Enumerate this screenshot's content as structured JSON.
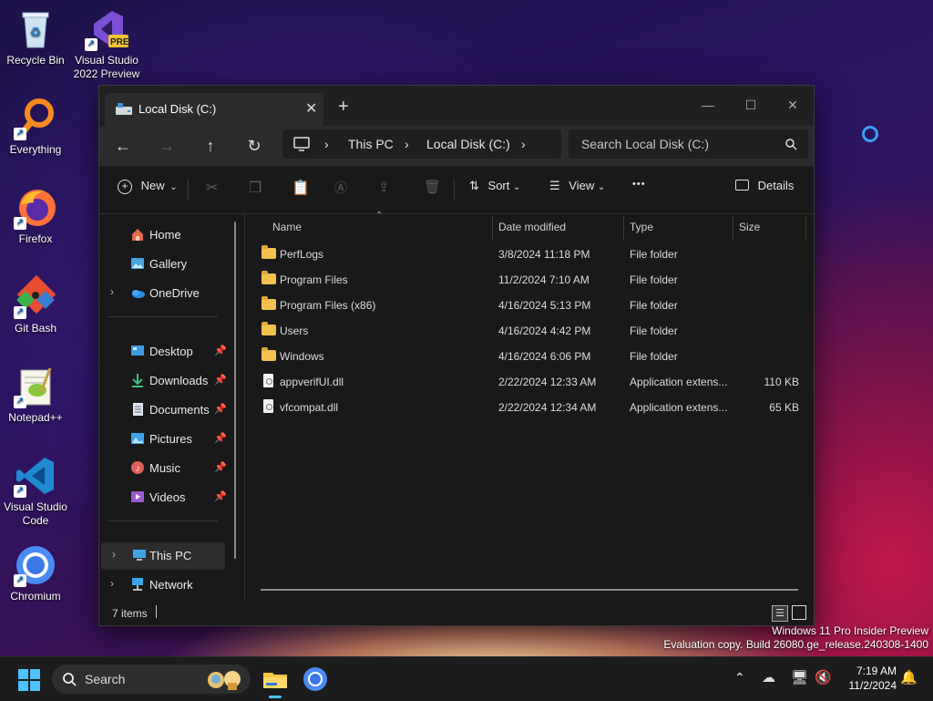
{
  "desktop": {
    "icons": [
      {
        "label": "Recycle Bin",
        "icon": "recycle-bin-icon"
      },
      {
        "label": "Visual Studio 2022 Preview",
        "icon": "visual-studio-preview-icon",
        "badge": "PRE"
      },
      {
        "label": "Everything",
        "icon": "everything-search-icon"
      },
      {
        "label": "Firefox",
        "icon": "firefox-icon"
      },
      {
        "label": "Git Bash",
        "icon": "git-bash-icon"
      },
      {
        "label": "Notepad++",
        "icon": "notepad-plus-plus-icon"
      },
      {
        "label": "Visual Studio Code",
        "icon": "vscode-icon"
      },
      {
        "label": "Chromium",
        "icon": "chromium-icon"
      }
    ]
  },
  "window": {
    "tab_title": "Local Disk (C:)",
    "breadcrumb": [
      "This PC",
      "Local Disk (C:)"
    ],
    "search_placeholder": "Search Local Disk (C:)",
    "toolbar": {
      "new_label": "New",
      "sort_label": "Sort",
      "view_label": "View",
      "more_label": "•••",
      "details_label": "Details"
    },
    "sidebar": {
      "top": [
        {
          "label": "Home",
          "icon": "home-icon"
        },
        {
          "label": "Gallery",
          "icon": "gallery-icon"
        },
        {
          "label": "OneDrive",
          "icon": "onedrive-icon"
        }
      ],
      "quick": [
        {
          "label": "Desktop",
          "icon": "desktop-folder-icon"
        },
        {
          "label": "Downloads",
          "icon": "downloads-icon"
        },
        {
          "label": "Documents",
          "icon": "documents-icon"
        },
        {
          "label": "Pictures",
          "icon": "pictures-icon"
        },
        {
          "label": "Music",
          "icon": "music-icon"
        },
        {
          "label": "Videos",
          "icon": "videos-icon"
        }
      ],
      "bottom": [
        {
          "label": "This PC",
          "icon": "this-pc-icon"
        },
        {
          "label": "Network",
          "icon": "network-icon"
        }
      ]
    },
    "columns": {
      "name": "Name",
      "date": "Date modified",
      "type": "Type",
      "size": "Size"
    },
    "files": [
      {
        "name": "PerfLogs",
        "date": "3/8/2024 11:18 PM",
        "type": "File folder",
        "size": "",
        "kind": "folder"
      },
      {
        "name": "Program Files",
        "date": "11/2/2024 7:10 AM",
        "type": "File folder",
        "size": "",
        "kind": "folder"
      },
      {
        "name": "Program Files (x86)",
        "date": "4/16/2024 5:13 PM",
        "type": "File folder",
        "size": "",
        "kind": "folder"
      },
      {
        "name": "Users",
        "date": "4/16/2024 4:42 PM",
        "type": "File folder",
        "size": "",
        "kind": "folder"
      },
      {
        "name": "Windows",
        "date": "4/16/2024 6:06 PM",
        "type": "File folder",
        "size": "",
        "kind": "folder"
      },
      {
        "name": "appverifUI.dll",
        "date": "2/22/2024 12:33 AM",
        "type": "Application extens...",
        "size": "110 KB",
        "kind": "file"
      },
      {
        "name": "vfcompat.dll",
        "date": "2/22/2024 12:34 AM",
        "type": "Application extens...",
        "size": "65 KB",
        "kind": "file"
      }
    ],
    "status_count": "7 items"
  },
  "watermark": {
    "line1": "Windows 11 Pro Insider Preview",
    "line2": "Evaluation copy. Build 26080.ge_release.240308-1400"
  },
  "taskbar": {
    "search_label": "Search",
    "time": "7:19 AM",
    "date": "11/2/2024"
  }
}
